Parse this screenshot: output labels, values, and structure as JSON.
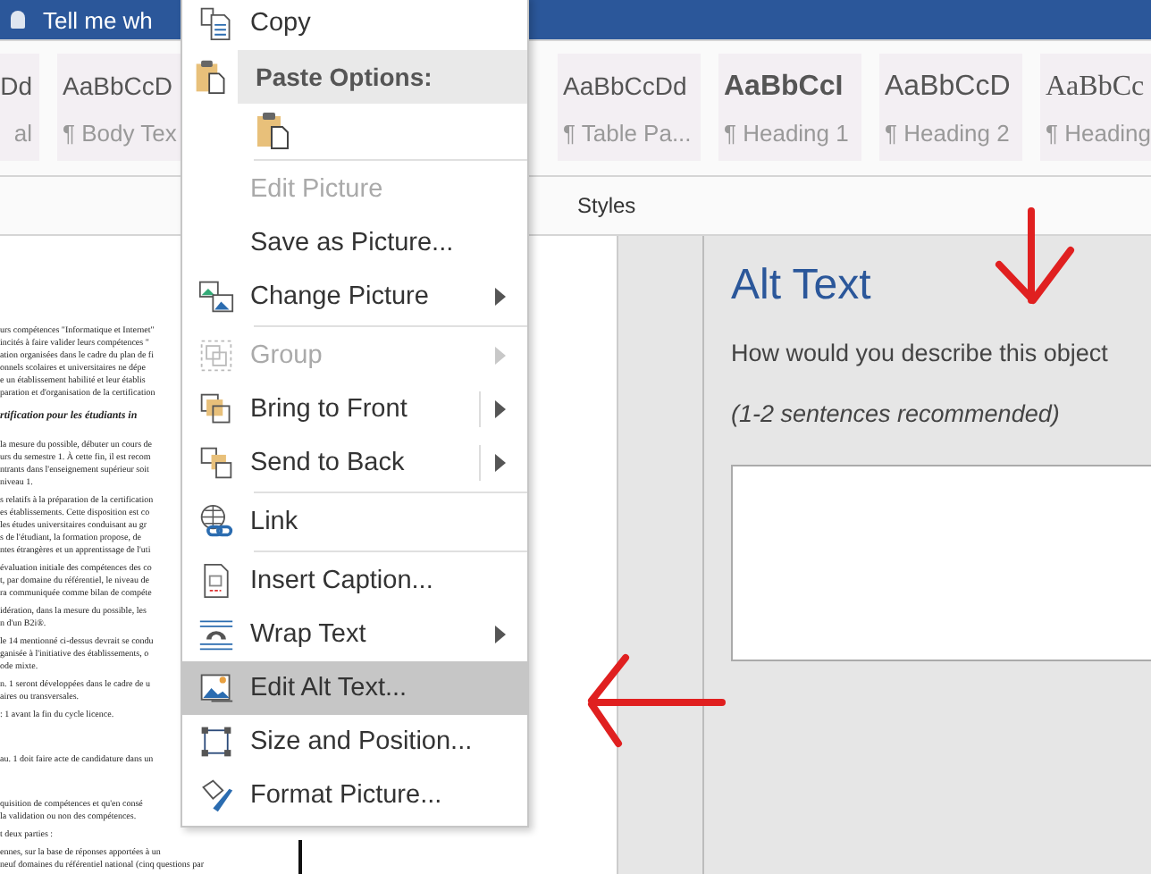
{
  "title_bar": {
    "search_hint": "Tell me wh"
  },
  "style_gallery": [
    {
      "preview": "Dd",
      "label": "al"
    },
    {
      "preview": "AaBbCcD",
      "label": "¶ Body Tex"
    },
    {
      "preview": "AaBbCcDd",
      "label": "¶ Table Pa..."
    },
    {
      "preview": "AaBbCcI",
      "label": "¶ Heading 1"
    },
    {
      "preview": "AaBbCcD",
      "label": "¶ Heading 2"
    },
    {
      "preview": "AaBbCc",
      "label": "¶ Heading"
    }
  ],
  "ribbon_group_label": "Styles",
  "document": {
    "paragraphs": [
      {
        "kind": "text",
        "lines": [
          "urs compétences \"Informatique et Internet\"",
          "incités à faire valider leurs compétences \"",
          "ation organisées dans le cadre du plan de fi",
          "onnels scolaires et universitaires ne dépe",
          "e un établissement habilité et leur établis",
          "paration et d'organisation de la certification"
        ]
      },
      {
        "kind": "heading",
        "lines": [
          "rtification pour les étudiants in"
        ]
      },
      {
        "kind": "text",
        "lines": [
          "la mesure du possible, débuter un cours de",
          "urs du semestre 1. À cette fin, il est recom",
          "ntrants dans l'enseignement supérieur soit",
          "niveau 1."
        ]
      },
      {
        "kind": "text",
        "lines": [
          "s relatifs à la préparation de la certification",
          "es établissements. Cette disposition est co",
          "les études universitaires conduisant au gr",
          "s de l'étudiant, la formation propose, de",
          "ntes étrangères et un apprentissage de l'uti"
        ]
      },
      {
        "kind": "text",
        "lines": [
          "évaluation initiale des compétences des co",
          "t, par domaine du référentiel, le niveau de",
          "ra communiquée comme bilan de compéte"
        ]
      },
      {
        "kind": "text",
        "lines": [
          "idération, dans la mesure du possible, les",
          "n d'un B2i®."
        ]
      },
      {
        "kind": "text",
        "lines": [
          "le 14 mentionné ci-dessus devrait se condu",
          "ganisée à l'initiative des établissements, o",
          "ode mixte."
        ]
      },
      {
        "kind": "text",
        "lines": [
          "n. 1 seront développées dans le cadre de u",
          "aires ou transversales."
        ]
      },
      {
        "kind": "text",
        "lines": [
          ": 1 avant la fin du cycle licence."
        ]
      },
      {
        "kind": "gap"
      },
      {
        "kind": "text",
        "lines": [
          "au. 1 doit faire acte de candidature dans un"
        ]
      },
      {
        "kind": "gap"
      },
      {
        "kind": "text",
        "lines": [
          "quisition de compétences et qu'en consé",
          "la validation ou non des compétences."
        ]
      },
      {
        "kind": "text",
        "lines": [
          "t deux parties :"
        ]
      },
      {
        "kind": "text",
        "lines": [
          "ennes, sur la base de réponses apportées à un",
          "neuf domaines du référentiel national (cinq questions par"
        ]
      }
    ]
  },
  "context_menu": [
    {
      "kind": "item",
      "label": "Copy",
      "disabled": false,
      "submenu": false,
      "split": false,
      "highlighted": false
    },
    {
      "kind": "header",
      "label": "Paste Options:"
    },
    {
      "kind": "paste-options"
    },
    {
      "kind": "separator"
    },
    {
      "kind": "item",
      "label": "Edit Picture",
      "disabled": true,
      "submenu": false,
      "split": false,
      "highlighted": false
    },
    {
      "kind": "item",
      "label": "Save as Picture...",
      "disabled": false,
      "submenu": false,
      "split": false,
      "highlighted": false
    },
    {
      "kind": "item",
      "label": "Change Picture",
      "disabled": false,
      "submenu": true,
      "split": false,
      "highlighted": false
    },
    {
      "kind": "separator"
    },
    {
      "kind": "item",
      "label": "Group",
      "disabled": true,
      "submenu": true,
      "split": false,
      "highlighted": false
    },
    {
      "kind": "item",
      "label": "Bring to Front",
      "disabled": false,
      "submenu": true,
      "split": true,
      "highlighted": false
    },
    {
      "kind": "item",
      "label": "Send to Back",
      "disabled": false,
      "submenu": true,
      "split": true,
      "highlighted": false
    },
    {
      "kind": "separator"
    },
    {
      "kind": "item",
      "label": "Link",
      "disabled": false,
      "submenu": false,
      "split": false,
      "highlighted": false
    },
    {
      "kind": "separator"
    },
    {
      "kind": "item",
      "label": "Insert Caption...",
      "disabled": false,
      "submenu": false,
      "split": false,
      "highlighted": false
    },
    {
      "kind": "item",
      "label": "Wrap Text",
      "disabled": false,
      "submenu": true,
      "split": false,
      "highlighted": false
    },
    {
      "kind": "item",
      "label": "Edit Alt Text...",
      "disabled": false,
      "submenu": false,
      "split": false,
      "highlighted": true
    },
    {
      "kind": "item",
      "label": "Size and Position...",
      "disabled": false,
      "submenu": false,
      "split": false,
      "highlighted": false
    },
    {
      "kind": "item",
      "label": "Format Picture...",
      "disabled": false,
      "submenu": false,
      "split": false,
      "highlighted": false
    }
  ],
  "alt_text_pane": {
    "title": "Alt Text",
    "question": "How would you describe this object",
    "hint": "(1-2 sentences recommended)"
  }
}
